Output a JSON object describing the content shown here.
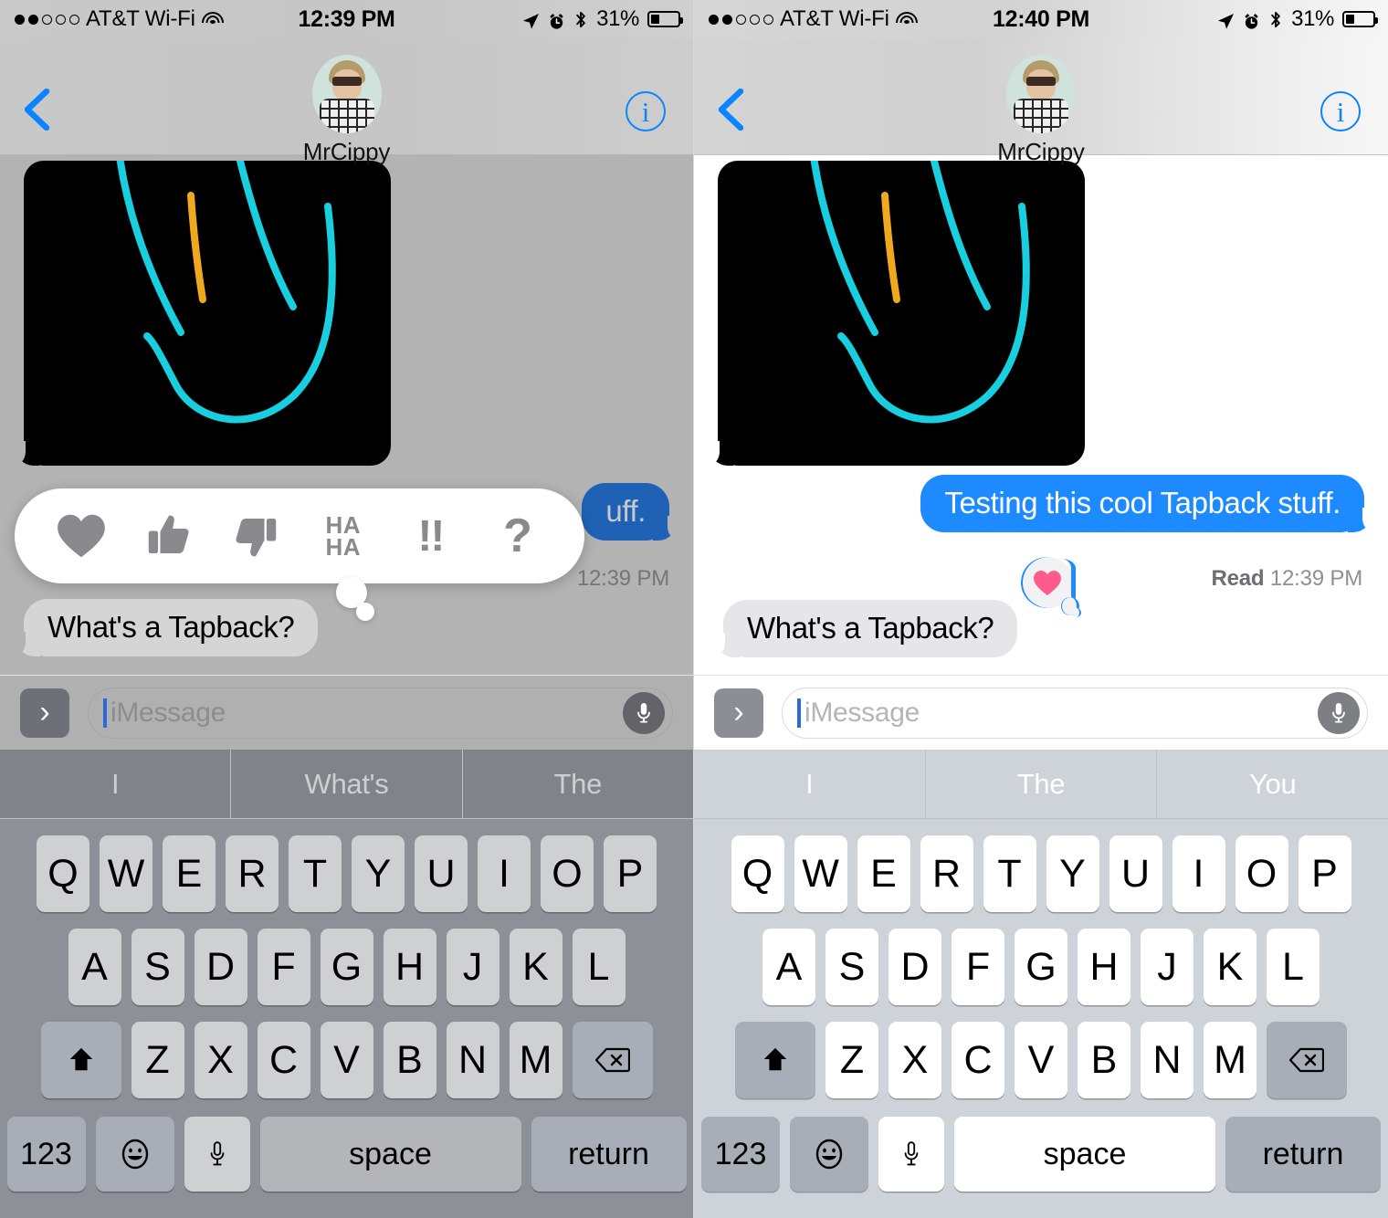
{
  "panels": [
    {
      "id": "left",
      "status": {
        "signal_filled": 2,
        "signal_total": 5,
        "carrier": "AT&T Wi-Fi",
        "wifi_icon": "wifi-icon",
        "time": "12:39 PM",
        "location_icon": "location-arrow-icon",
        "alarm_icon": "alarm-clock-icon",
        "bluetooth_icon": "bluetooth-icon",
        "battery_percent": "31%",
        "battery_level": 31
      },
      "nav": {
        "back_icon": "back-chevron-icon",
        "info_icon": "info-icon",
        "info_label": "i",
        "contact_name": "MrCippy",
        "avatar_icon": "contact-avatar"
      },
      "conversation": {
        "image_message": {
          "name": "handwritten-drawing-attachment",
          "background": "#000000"
        },
        "outgoing": {
          "text": "Testing this cool Tapback stuff.",
          "visible_fragment": "uff.",
          "color": "#1d8aff"
        },
        "outgoing_receipt": {
          "status": "",
          "time": "12:39 PM"
        },
        "incoming": {
          "text": "What's a Tapback?",
          "color": "#e6e5ea"
        }
      },
      "tapback_picker": {
        "visible": true,
        "options": [
          {
            "id": "heart",
            "icon": "heart-icon",
            "label": ""
          },
          {
            "id": "thumbs-up",
            "icon": "thumbs-up-icon",
            "label": ""
          },
          {
            "id": "thumbs-down",
            "icon": "thumbs-down-icon",
            "label": ""
          },
          {
            "id": "haha",
            "icon": "haha-icon",
            "label": "HA HA"
          },
          {
            "id": "exclamation",
            "icon": "double-exclamation-icon",
            "label": "!!"
          },
          {
            "id": "question",
            "icon": "question-mark-icon",
            "label": "?"
          }
        ]
      },
      "input": {
        "app_button_icon": "app-drawer-chevron-icon",
        "placeholder": "iMessage",
        "value": "",
        "mic_icon": "microphone-icon"
      },
      "keyboard": {
        "suggestions": [
          "I",
          "What's",
          "The"
        ],
        "row1": [
          "Q",
          "W",
          "E",
          "R",
          "T",
          "Y",
          "U",
          "I",
          "O",
          "P"
        ],
        "row2": [
          "A",
          "S",
          "D",
          "F",
          "G",
          "H",
          "J",
          "K",
          "L"
        ],
        "row3": [
          "Z",
          "X",
          "C",
          "V",
          "B",
          "N",
          "M"
        ],
        "shift_icon": "shift-arrow-icon",
        "backspace_icon": "backspace-icon",
        "numbers_label": "123",
        "emoji_icon": "emoji-smiley-icon",
        "dictation_icon": "microphone-icon",
        "space_label": "space",
        "return_label": "return"
      },
      "dimmed": true
    },
    {
      "id": "right",
      "status": {
        "signal_filled": 2,
        "signal_total": 5,
        "carrier": "AT&T Wi-Fi",
        "wifi_icon": "wifi-icon",
        "time": "12:40 PM",
        "location_icon": "location-arrow-icon",
        "alarm_icon": "alarm-clock-icon",
        "bluetooth_icon": "bluetooth-icon",
        "battery_percent": "31%",
        "battery_level": 31
      },
      "nav": {
        "back_icon": "back-chevron-icon",
        "info_icon": "info-icon",
        "info_label": "i",
        "contact_name": "MrCippy",
        "avatar_icon": "contact-avatar"
      },
      "conversation": {
        "image_message": {
          "name": "handwritten-drawing-attachment",
          "background": "#000000"
        },
        "outgoing": {
          "text": "Testing this cool Tapback stuff.",
          "visible_fragment": "Testing this cool Tapback stuff.",
          "color": "#1d8aff"
        },
        "outgoing_receipt": {
          "status": "Read",
          "time": "12:39 PM"
        },
        "incoming": {
          "text": "What's a Tapback?",
          "color": "#e6e5ea"
        },
        "tapback_applied": {
          "icon": "heart-icon",
          "color": "#ff5c8d",
          "outline": "#1d8aff"
        }
      },
      "tapback_picker": {
        "visible": false,
        "options": []
      },
      "input": {
        "app_button_icon": "app-drawer-chevron-icon",
        "placeholder": "iMessage",
        "value": "",
        "mic_icon": "microphone-icon"
      },
      "keyboard": {
        "suggestions": [
          "I",
          "The",
          "You"
        ],
        "row1": [
          "Q",
          "W",
          "E",
          "R",
          "T",
          "Y",
          "U",
          "I",
          "O",
          "P"
        ],
        "row2": [
          "A",
          "S",
          "D",
          "F",
          "G",
          "H",
          "J",
          "K",
          "L"
        ],
        "row3": [
          "Z",
          "X",
          "C",
          "V",
          "B",
          "N",
          "M"
        ],
        "shift_icon": "shift-arrow-icon",
        "backspace_icon": "backspace-icon",
        "numbers_label": "123",
        "emoji_icon": "emoji-smiley-icon",
        "dictation_icon": "microphone-icon",
        "space_label": "space",
        "return_label": "return"
      },
      "dimmed": false
    }
  ],
  "drawing": {
    "stroke_color_primary": "#18cfe0",
    "stroke_color_accent": "#f0a91e"
  }
}
